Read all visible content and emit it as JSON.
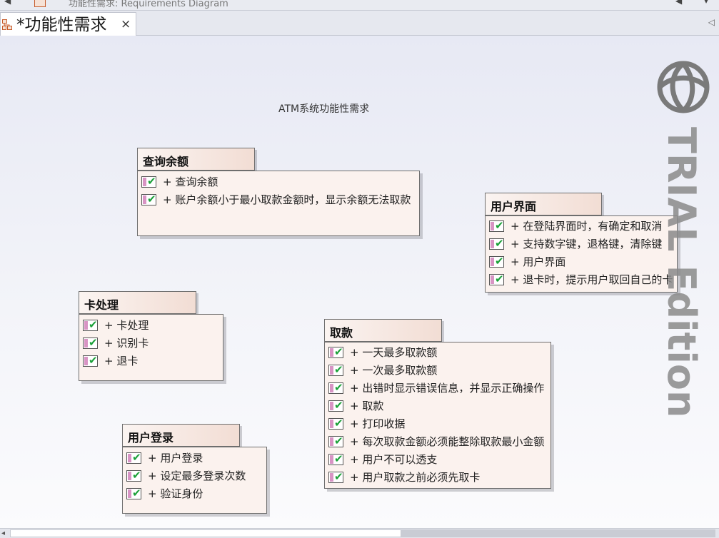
{
  "window": {
    "top_title": "功能性需求:  Requirements Diagram"
  },
  "tab": {
    "label": "*功能性需求",
    "close": "×"
  },
  "diagram": {
    "title": "ATM系统功能性需求",
    "watermark": "TRIAL Edition",
    "packages": [
      {
        "name": "查询余额",
        "items": [
          "+ 查询余额",
          "+ 账户余额小于最小取款金额时，显示余额无法取款"
        ]
      },
      {
        "name": "用户界面",
        "items": [
          "+ 在登陆界面时，有确定和取消",
          "+ 支持数字键，退格键，清除键",
          "+ 用户界面",
          "+ 退卡时，提示用户取回自己的卡"
        ]
      },
      {
        "name": "卡处理",
        "items": [
          "+ 卡处理",
          "+ 识别卡",
          "+ 退卡"
        ]
      },
      {
        "name": "取款",
        "items": [
          "+ 一天最多取款额",
          "+ 一次最多取款额",
          "+ 出错时显示错误信息，并显示正确操作",
          "+ 取款",
          "+ 打印收据",
          "+ 每次取款金额必须能整除取款最小金额",
          "+ 用户不可以透支",
          "+ 用户取款之前必须先取卡"
        ]
      },
      {
        "name": "用户登录",
        "items": [
          "+ 用户登录",
          "+ 设定最多登录次数",
          "+ 验证身份"
        ]
      }
    ]
  },
  "colors": {
    "check": "#1aa038",
    "requirement_bar": "#d894c4",
    "package_fill": "#fbf2ee"
  }
}
